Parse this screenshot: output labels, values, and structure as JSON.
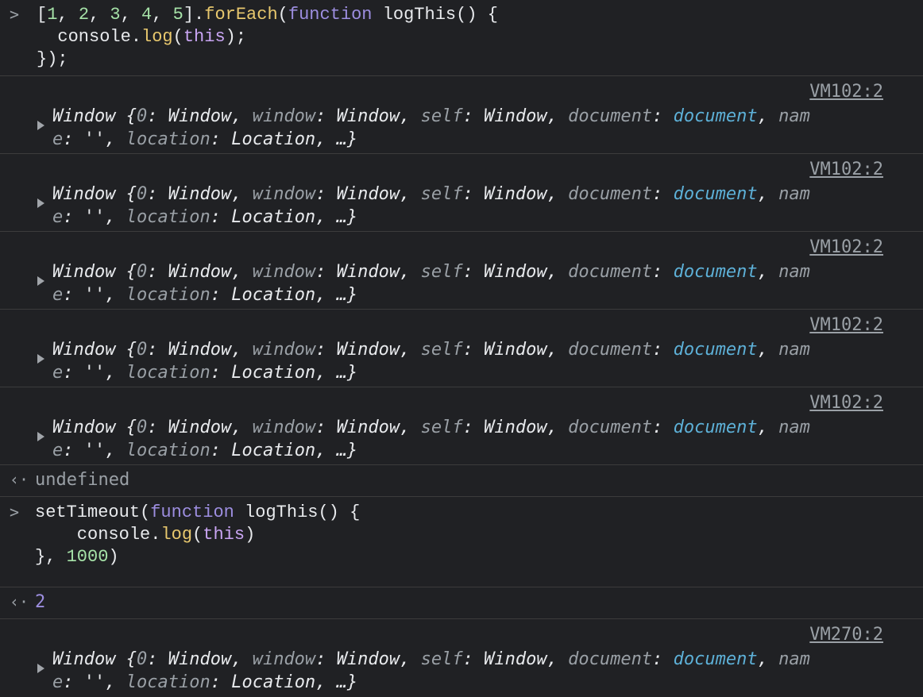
{
  "entry1": {
    "prompt": ">",
    "line1": {
      "open": "[",
      "n1": "1",
      "sep": ", ",
      "n2": "2",
      "n3": "3",
      "n4": "4",
      "n5": "5",
      "close": "].",
      "method": "forEach",
      "paren": "(",
      "kw": "function",
      "name": " logThis() {"
    },
    "line2": {
      "indent": "  console.",
      "method": "log",
      "paren": "(",
      "arg": "this",
      "end": ");"
    },
    "line3": "});"
  },
  "log_object": {
    "prefix": "Window {",
    "k0": "0",
    "v_window": "Window",
    "k_window": "window",
    "k_self": "self",
    "k_document": "document",
    "v_document": "document",
    "k_name_part1": "nam",
    "k_name_part2": "e",
    "v_name": "''",
    "k_location": "location",
    "v_location": "Location",
    "ellipsis": "…}"
  },
  "logs": [
    {
      "source": "VM102:2"
    },
    {
      "source": "VM102:2"
    },
    {
      "source": "VM102:2"
    },
    {
      "source": "VM102:2"
    },
    {
      "source": "VM102:2"
    },
    {
      "source": "VM270:2"
    }
  ],
  "result1": {
    "prompt": "‹·",
    "value": "undefined"
  },
  "entry2": {
    "prompt": ">",
    "line1": {
      "fn": "setTimeout(",
      "kw": "function",
      "name": " logThis() {"
    },
    "line2": {
      "indent": "    console.",
      "method": "log",
      "paren": "(",
      "arg": "this",
      "end": ")"
    },
    "line3": {
      "start": "}, ",
      "num": "1000",
      "end": ")"
    }
  },
  "result2": {
    "prompt": "‹·",
    "value": "2"
  }
}
